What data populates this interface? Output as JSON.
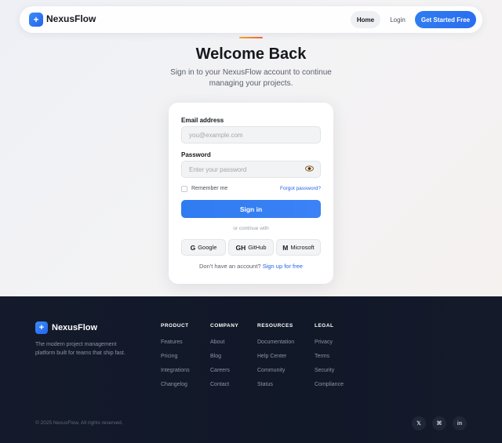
{
  "nav": {
    "brand_icon": "+",
    "brand": "NexusFlow",
    "home": "Home",
    "login": "Login",
    "cta": "Get Started Free"
  },
  "header": {
    "title": "Welcome Back",
    "subtitle": "Sign in to your NexusFlow account to continue managing your projects."
  },
  "form": {
    "email_label": "Email address",
    "email_placeholder": "you@example.com",
    "password_label": "Password",
    "password_placeholder": "Enter your password",
    "remember": "Remember me",
    "forgot": "Forgot password?",
    "signin": "Sign in",
    "divider": "or continue with",
    "social": [
      {
        "glyph": "G",
        "label": "Google"
      },
      {
        "glyph": "GH",
        "label": "GitHub"
      },
      {
        "glyph": "M",
        "label": "Microsoft"
      }
    ],
    "signup_prompt": "Don't have an account?",
    "signup_link": "Sign up for free"
  },
  "footer": {
    "brand_icon": "+",
    "brand": "NexusFlow",
    "tagline": "The modern project management platform built for teams that ship fast.",
    "columns": [
      {
        "title": "PRODUCT",
        "items": [
          "Features",
          "Pricing",
          "Integrations",
          "Changelog"
        ]
      },
      {
        "title": "COMPANY",
        "items": [
          "About",
          "Blog",
          "Careers",
          "Contact"
        ]
      },
      {
        "title": "RESOURCES",
        "items": [
          "Documentation",
          "Help Center",
          "Community",
          "Status"
        ]
      },
      {
        "title": "LEGAL",
        "items": [
          "Privacy",
          "Terms",
          "Security",
          "Compliance"
        ]
      }
    ],
    "copyright": "© 2025 NexusFlow. All rights reserved.",
    "social": [
      "𝕏",
      "⌘",
      "in"
    ]
  },
  "colors": {
    "accent": "#2f7cf0",
    "footer_bg": "#141a2b"
  }
}
